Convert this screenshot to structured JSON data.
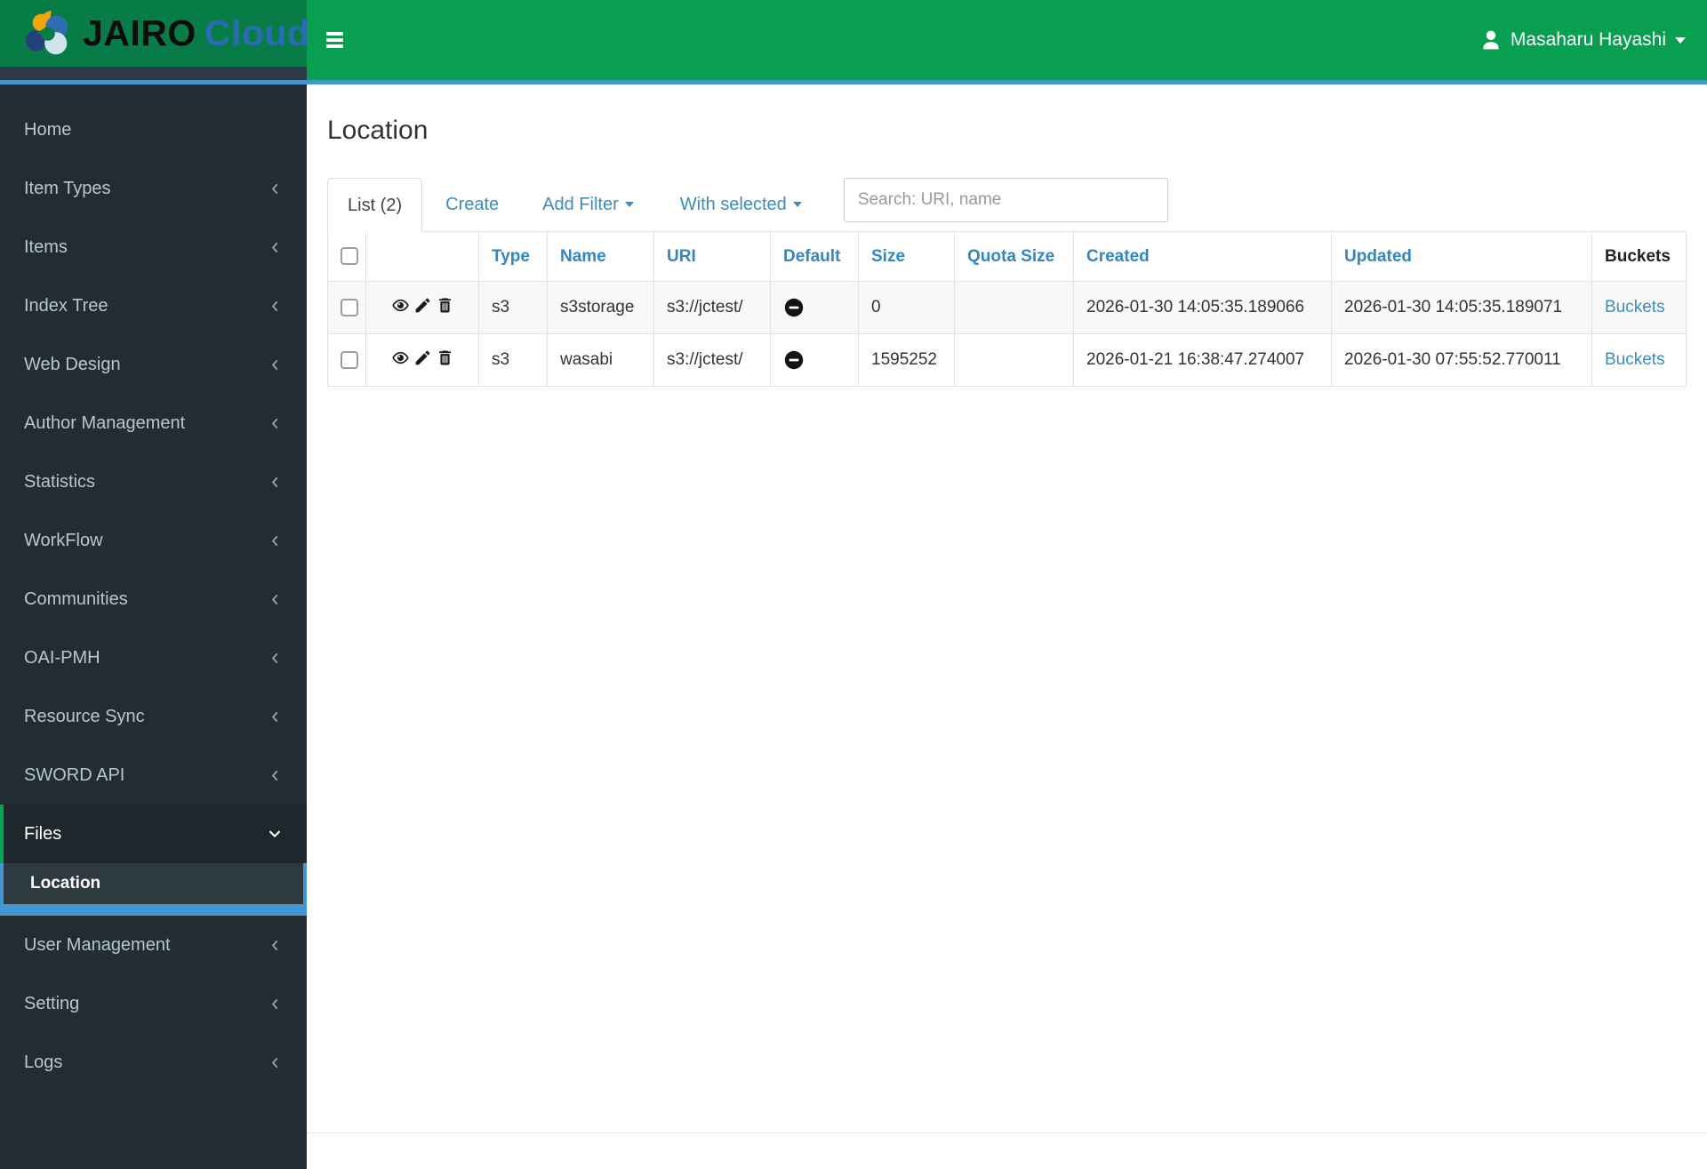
{
  "header": {
    "logo": {
      "title_primary": "JAIRO",
      "title_secondary": "Cloud"
    },
    "user": {
      "name": "Masaharu Hayashi"
    }
  },
  "sidebar": {
    "items": [
      {
        "label": "Home",
        "chevron": "none"
      },
      {
        "label": "Item Types",
        "chevron": "left"
      },
      {
        "label": "Items",
        "chevron": "left"
      },
      {
        "label": "Index Tree",
        "chevron": "left"
      },
      {
        "label": "Web Design",
        "chevron": "left"
      },
      {
        "label": "Author Management",
        "chevron": "left"
      },
      {
        "label": "Statistics",
        "chevron": "left"
      },
      {
        "label": "WorkFlow",
        "chevron": "left"
      },
      {
        "label": "Communities",
        "chevron": "left"
      },
      {
        "label": "OAI-PMH",
        "chevron": "left"
      },
      {
        "label": "Resource Sync",
        "chevron": "left"
      },
      {
        "label": "SWORD API",
        "chevron": "left"
      },
      {
        "label": "Files",
        "chevron": "down",
        "active": true,
        "children": [
          {
            "label": "Location",
            "active": true
          }
        ]
      },
      {
        "label": "User Management",
        "chevron": "left"
      },
      {
        "label": "Setting",
        "chevron": "left"
      },
      {
        "label": "Logs",
        "chevron": "left"
      }
    ]
  },
  "main": {
    "title": "Location",
    "toolbar": {
      "active_tab": "List (2)",
      "create_label": "Create",
      "add_filter_label": "Add Filter",
      "with_selected_label": "With selected",
      "search_placeholder": "Search: URI, name"
    },
    "table": {
      "headers": [
        {
          "label": "",
          "kind": "checkbox"
        },
        {
          "label": "",
          "kind": "actions"
        },
        {
          "label": "Type",
          "sortable": true
        },
        {
          "label": "Name",
          "sortable": true
        },
        {
          "label": "URI",
          "sortable": true
        },
        {
          "label": "Default",
          "sortable": true
        },
        {
          "label": "Size",
          "sortable": true
        },
        {
          "label": "Quota Size",
          "sortable": true
        },
        {
          "label": "Created",
          "sortable": true
        },
        {
          "label": "Updated",
          "sortable": true
        },
        {
          "label": "Buckets",
          "sortable": false
        }
      ],
      "row_action_icons": [
        "view-icon",
        "edit-icon",
        "delete-icon"
      ],
      "default_icon": "minus-circle-icon",
      "rows": [
        {
          "type": "s3",
          "name": "s3storage",
          "uri": "s3://jctest/",
          "default": "minus-circle-icon",
          "size": "0",
          "quota_size": "",
          "created": "2026-01-30 14:05:35.189066",
          "updated": "2026-01-30 14:05:35.189071",
          "buckets_label": "Buckets"
        },
        {
          "type": "s3",
          "name": "wasabi",
          "uri": "s3://jctest/",
          "default": "minus-circle-icon",
          "size": "1595252",
          "quota_size": "",
          "created": "2026-01-21 16:38:47.274007",
          "updated": "2026-01-30 07:55:52.770011",
          "buckets_label": "Buckets"
        }
      ]
    }
  },
  "colors": {
    "header_green": "#08a050",
    "logo_green": "#087c46",
    "accent_blue": "#4296d2",
    "sidebar_dark": "#222d32",
    "active_item_green": "#00a65a",
    "link_blue": "#3c8dbc",
    "table_header_blue": "#3486c0",
    "row_stripe": "#f9f9f9"
  }
}
